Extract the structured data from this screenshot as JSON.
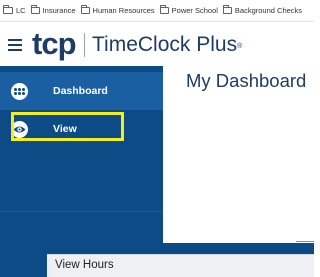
{
  "bookmarks": [
    {
      "label": "LC",
      "icon": "apps-folder-icon"
    },
    {
      "label": "Insurance",
      "icon": "folder-icon"
    },
    {
      "label": "Human Resources",
      "icon": "folder-icon"
    },
    {
      "label": "Power School",
      "icon": "folder-icon"
    },
    {
      "label": "Background Checks",
      "icon": "folder-icon"
    }
  ],
  "header": {
    "logo_mark": "tcp",
    "brand_name": "TimeClock Plus",
    "trademark": "®"
  },
  "sidebar": {
    "items": [
      {
        "label": "Dashboard",
        "icon": "dashboard-dots-icon",
        "active": true
      },
      {
        "label": "View",
        "icon": "eye-icon",
        "highlighted": true
      }
    ]
  },
  "main": {
    "title": "My Dashboard"
  },
  "panel": {
    "title": "View Hours"
  },
  "colors": {
    "sidebar_bg": "#0c4b86",
    "sidebar_active": "#1b5fa3",
    "brand_navy": "#1f3c66",
    "highlight": "#f2ef18"
  }
}
